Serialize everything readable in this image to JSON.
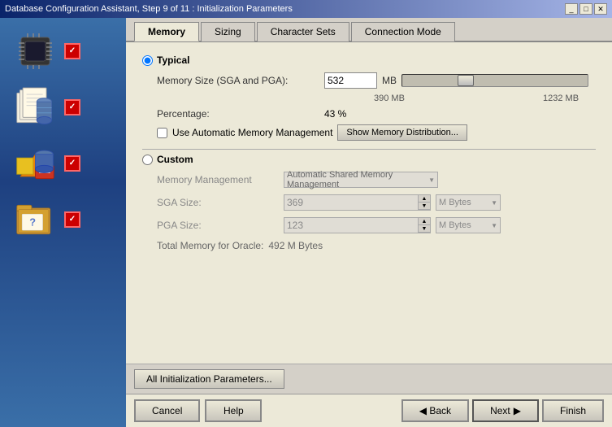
{
  "titleBar": {
    "title": "Database Configuration Assistant, Step 9 of 11 : Initialization Parameters",
    "buttons": [
      "_",
      "□",
      "✕"
    ]
  },
  "tabs": [
    {
      "id": "memory",
      "label": "Memory",
      "active": true
    },
    {
      "id": "sizing",
      "label": "Sizing",
      "active": false
    },
    {
      "id": "charsets",
      "label": "Character Sets",
      "active": false
    },
    {
      "id": "connmode",
      "label": "Connection Mode",
      "active": false
    }
  ],
  "typical": {
    "label": "Typical",
    "memoryLabel": "Memory Size (SGA and PGA):",
    "memoryValue": "532",
    "memoryUnit": "MB",
    "sliderMin": "390 MB",
    "sliderMax": "1232 MB",
    "percentLabel": "Percentage:",
    "percentValue": "43 %",
    "checkboxLabel": "Use Automatic Memory Management",
    "showBtn": "Show Memory Distribution..."
  },
  "custom": {
    "label": "Custom",
    "memMgmtLabel": "Memory Management",
    "memMgmtValue": "Automatic Shared Memory Management",
    "sgaLabel": "SGA Size:",
    "sgaValue": "369",
    "pgaLabel": "PGA Size:",
    "pgaValue": "123",
    "unitLabel": "M Bytes",
    "totalLabel": "Total Memory for Oracle:",
    "totalValue": "492 M Bytes"
  },
  "bottomBar": {
    "allParamsBtn": "All Initialization Parameters..."
  },
  "footer": {
    "cancelBtn": "Cancel",
    "helpBtn": "Help",
    "backBtn": "Back",
    "nextBtn": "Next",
    "finishBtn": "Finish"
  }
}
